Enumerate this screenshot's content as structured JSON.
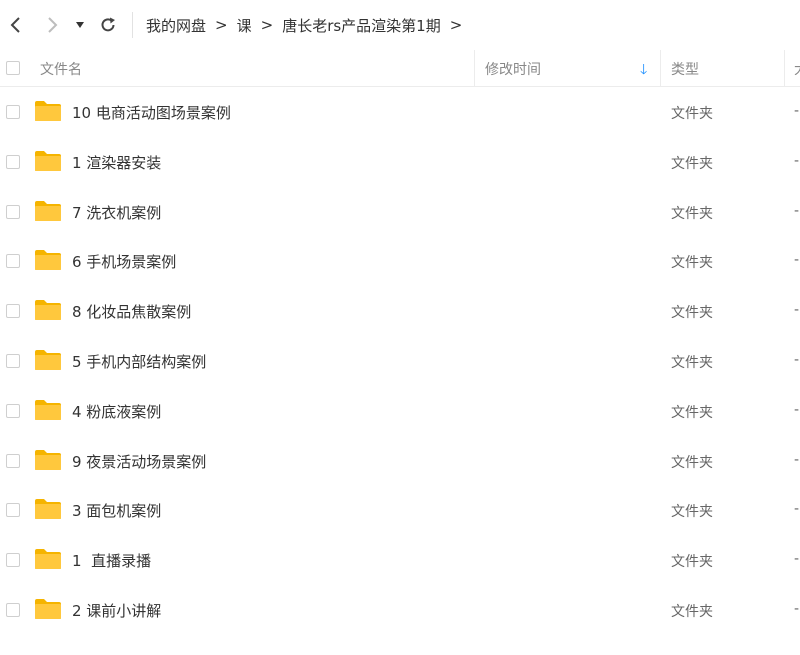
{
  "toolbar": {
    "back_icon": "chevron-left-icon",
    "forward_icon": "chevron-right-icon",
    "dropdown_icon": "caret-down-icon",
    "refresh_icon": "refresh-icon"
  },
  "breadcrumb": {
    "items": [
      "我的网盘",
      "课",
      "唐长老rs产品渲染第1期"
    ],
    "separator": ">",
    "trailing": ">"
  },
  "table_header": {
    "name": "文件名",
    "modified": "修改时间",
    "sort_icon": "arrow-down-icon",
    "type": "类型",
    "size": "大"
  },
  "colors": {
    "folder": "#FFC83D",
    "folder_dark": "#F5B400",
    "sort_accent": "#1E90FF"
  },
  "files": [
    {
      "name": "10 电商活动图场景案例",
      "type": "文件夹",
      "size": "-"
    },
    {
      "name": "1 渲染器安装",
      "type": "文件夹",
      "size": "-"
    },
    {
      "name": "7 洗衣机案例",
      "type": "文件夹",
      "size": "-"
    },
    {
      "name": "6 手机场景案例",
      "type": "文件夹",
      "size": "-"
    },
    {
      "name": "8 化妆品焦散案例",
      "type": "文件夹",
      "size": "-"
    },
    {
      "name": "5 手机内部结构案例",
      "type": "文件夹",
      "size": "-"
    },
    {
      "name": "4 粉底液案例",
      "type": "文件夹",
      "size": "-"
    },
    {
      "name": "9 夜景活动场景案例",
      "type": "文件夹",
      "size": "-"
    },
    {
      "name": "3 面包机案例",
      "type": "文件夹",
      "size": "-"
    },
    {
      "name": "1  直播录播",
      "type": "文件夹",
      "size": "-"
    },
    {
      "name": "2 课前小讲解",
      "type": "文件夹",
      "size": "-"
    }
  ]
}
